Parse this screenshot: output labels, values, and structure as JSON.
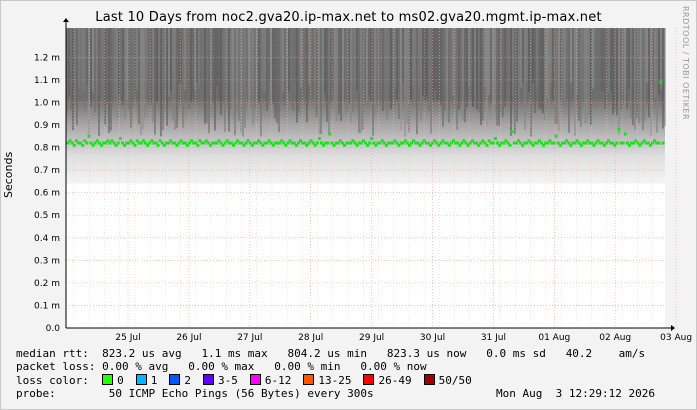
{
  "title": "Last 10 Days from noc2.gva20.ip-max.net to ms02.gva20.mgmt.ip-max.net",
  "credit": "RRDTOOL / TOBI OETIKER",
  "chart_data": {
    "type": "line",
    "title": "Last 10 Days from noc2.gva20.ip-max.net to ms02.gva20.mgmt.ip-max.net",
    "xlabel": "",
    "ylabel": "Seconds",
    "yticks": [
      "0.0",
      "0.1 m",
      "0.2 m",
      "0.3 m",
      "0.4 m",
      "0.5 m",
      "0.6 m",
      "0.7 m",
      "0.8 m",
      "0.9 m",
      "1.0 m",
      "1.1 m",
      "1.2 m"
    ],
    "ylim": [
      0,
      0.00133
    ],
    "xticks": [
      "25 Jul",
      "26 Jul",
      "27 Jul",
      "28 Jul",
      "29 Jul",
      "30 Jul",
      "31 Jul",
      "01 Aug",
      "02 Aug",
      "03 Aug"
    ],
    "grid": true,
    "smoke_band": {
      "low": 0.00064,
      "high": 0.00133,
      "description": "grey latency distribution band"
    },
    "series": [
      {
        "name": "median rtt",
        "color": "#22dd22",
        "points_ms": [
          0.82,
          0.83,
          0.82,
          0.81,
          0.83,
          0.82,
          0.82,
          0.81,
          0.83,
          0.82,
          0.85,
          0.82,
          0.81,
          0.82,
          0.83,
          0.82,
          0.81,
          0.82,
          0.82,
          0.83,
          0.82,
          0.83,
          0.82,
          0.81,
          0.82,
          0.84,
          0.82,
          0.81,
          0.82,
          0.82,
          0.83,
          0.82,
          0.81,
          0.83,
          0.82,
          0.82,
          0.83,
          0.82,
          0.81,
          0.82,
          0.83,
          0.82,
          0.82,
          0.81,
          0.83,
          0.82,
          0.81,
          0.82,
          0.82,
          0.83,
          0.82,
          0.82,
          0.81,
          0.82,
          0.83,
          0.82,
          0.82,
          0.81,
          0.82,
          0.83,
          0.82,
          0.82,
          0.81,
          0.83,
          0.82,
          0.82,
          0.83,
          0.82,
          0.81,
          0.82,
          0.82,
          0.82,
          0.83,
          0.82,
          0.81,
          0.82,
          0.83,
          0.82,
          0.82,
          0.81,
          0.82,
          0.83,
          0.82,
          0.82,
          0.81,
          0.82,
          0.83,
          0.82,
          0.81,
          0.82,
          0.82,
          0.83,
          0.82,
          0.81,
          0.82,
          0.82,
          0.83,
          0.82,
          0.81,
          0.82,
          0.82,
          0.82,
          0.83,
          0.82,
          0.81,
          0.82,
          0.83,
          0.82,
          0.82,
          0.81,
          0.82,
          0.83,
          0.82,
          0.82,
          0.81,
          0.82,
          0.83,
          0.82,
          0.81,
          0.82,
          0.84,
          0.82,
          0.81,
          0.82,
          0.82,
          0.86,
          0.82,
          0.81,
          0.82,
          0.82,
          0.83,
          0.82,
          0.81,
          0.82,
          0.82,
          0.82,
          0.83,
          0.82,
          0.81,
          0.82,
          0.82,
          0.83,
          0.82,
          0.81,
          0.82,
          0.84,
          0.82,
          0.81,
          0.82,
          0.82,
          0.83,
          0.82,
          0.81,
          0.82,
          0.82,
          0.82,
          0.83,
          0.82,
          0.81,
          0.82,
          0.82,
          0.83,
          0.82,
          0.81,
          0.82,
          0.83,
          0.82,
          0.82,
          0.81,
          0.82,
          0.83,
          0.82,
          0.82,
          0.81,
          0.82,
          0.83,
          0.82,
          0.81,
          0.82,
          0.83,
          0.82,
          0.82,
          0.81,
          0.82,
          0.83,
          0.82,
          0.82,
          0.81,
          0.82,
          0.83,
          0.82,
          0.81,
          0.82,
          0.83,
          0.82,
          0.82,
          0.81,
          0.82,
          0.83,
          0.82,
          0.81,
          0.83,
          0.82,
          0.82,
          0.84,
          0.82,
          0.81,
          0.82,
          0.82,
          0.83,
          0.82,
          0.81,
          0.87,
          0.82,
          0.82,
          0.83,
          0.82,
          0.81,
          0.82,
          0.82,
          0.83,
          0.82,
          0.81,
          0.82,
          0.82,
          0.83,
          0.82,
          0.81,
          0.82,
          0.82,
          0.83,
          0.82,
          0.82,
          0.85,
          0.82,
          0.81,
          0.82,
          0.82,
          0.83,
          0.82,
          0.81,
          0.82,
          0.82,
          0.83,
          0.82,
          0.81,
          0.82,
          0.82,
          0.83,
          0.82,
          0.82,
          0.81,
          0.82,
          0.83,
          0.82,
          0.82,
          0.81,
          0.82,
          0.83,
          0.82,
          0.82,
          0.81,
          0.82,
          0.88,
          0.82,
          0.82,
          0.86,
          0.82,
          0.81,
          0.82,
          0.82,
          0.83,
          0.82,
          0.81,
          0.82,
          0.83,
          0.82,
          0.82,
          0.81,
          0.82,
          0.83,
          0.82,
          0.82,
          1.09,
          0.82
        ]
      }
    ]
  },
  "stats": {
    "median_label": "median rtt:",
    "median_values": "823.2 us avg   1.1 ms max   804.2 us min   823.3 us now   0.0 ms sd   40.2    am/s",
    "loss_label": "packet loss:",
    "loss_values": "0.00 % avg   0.00 % max   0.00 % min   0.00 % now",
    "color_label": "loss color:",
    "loss_colors": [
      {
        "label": "0",
        "color": "#26ff00"
      },
      {
        "label": "1",
        "color": "#00b8ff"
      },
      {
        "label": "2",
        "color": "#0059ff"
      },
      {
        "label": "3-5",
        "color": "#5e00ff"
      },
      {
        "label": "6-12",
        "color": "#ff00ff"
      },
      {
        "label": "13-25",
        "color": "#ff5500"
      },
      {
        "label": "26-49",
        "color": "#ff0000"
      },
      {
        "label": "50/50",
        "color": "#a10000"
      }
    ],
    "probe_label": "probe:",
    "probe_value": "50 ICMP Echo Pings (56 Bytes) every 300s",
    "probe_date": "Mon Aug  3 12:29:12 2026"
  }
}
